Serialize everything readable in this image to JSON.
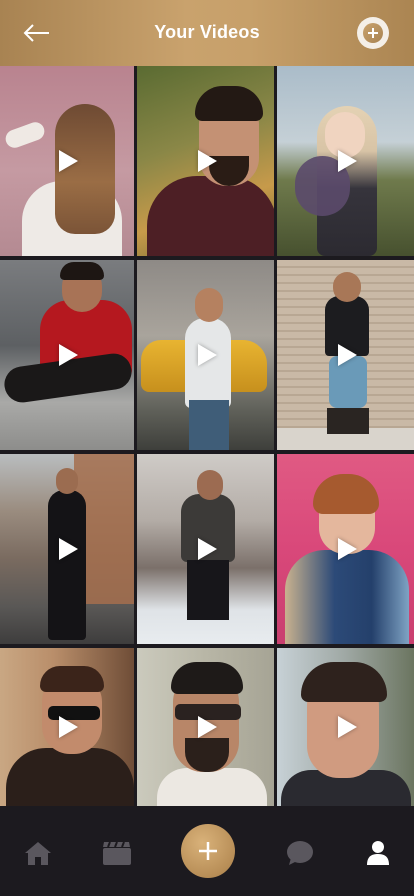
{
  "header": {
    "title": "Your Videos",
    "back_icon": "arrow-left-icon",
    "add_icon": "plus-circle-icon"
  },
  "colors": {
    "accent": "#c19a63",
    "background": "#1c1a1f",
    "nav_inactive": "#5a575e",
    "nav_active": "#ffffff"
  },
  "videos": [
    {
      "label": "woman-long-hair-back"
    },
    {
      "label": "man-beard-profile"
    },
    {
      "label": "blonde-girl-flowers"
    },
    {
      "label": "man-red-shirt-sitting"
    },
    {
      "label": "boy-yellow-car"
    },
    {
      "label": "boy-black-tshirt-wall"
    },
    {
      "label": "man-black-outfit-street"
    },
    {
      "label": "man-jacket-snow"
    },
    {
      "label": "woman-pink-wall"
    },
    {
      "label": "man-sunglasses-1"
    },
    {
      "label": "man-sunglasses-2"
    },
    {
      "label": "man-portrait-3"
    }
  ],
  "nav": {
    "items": [
      "home-icon",
      "videos-icon",
      "add-icon",
      "chat-icon",
      "profile-icon"
    ],
    "active": "profile-icon"
  }
}
